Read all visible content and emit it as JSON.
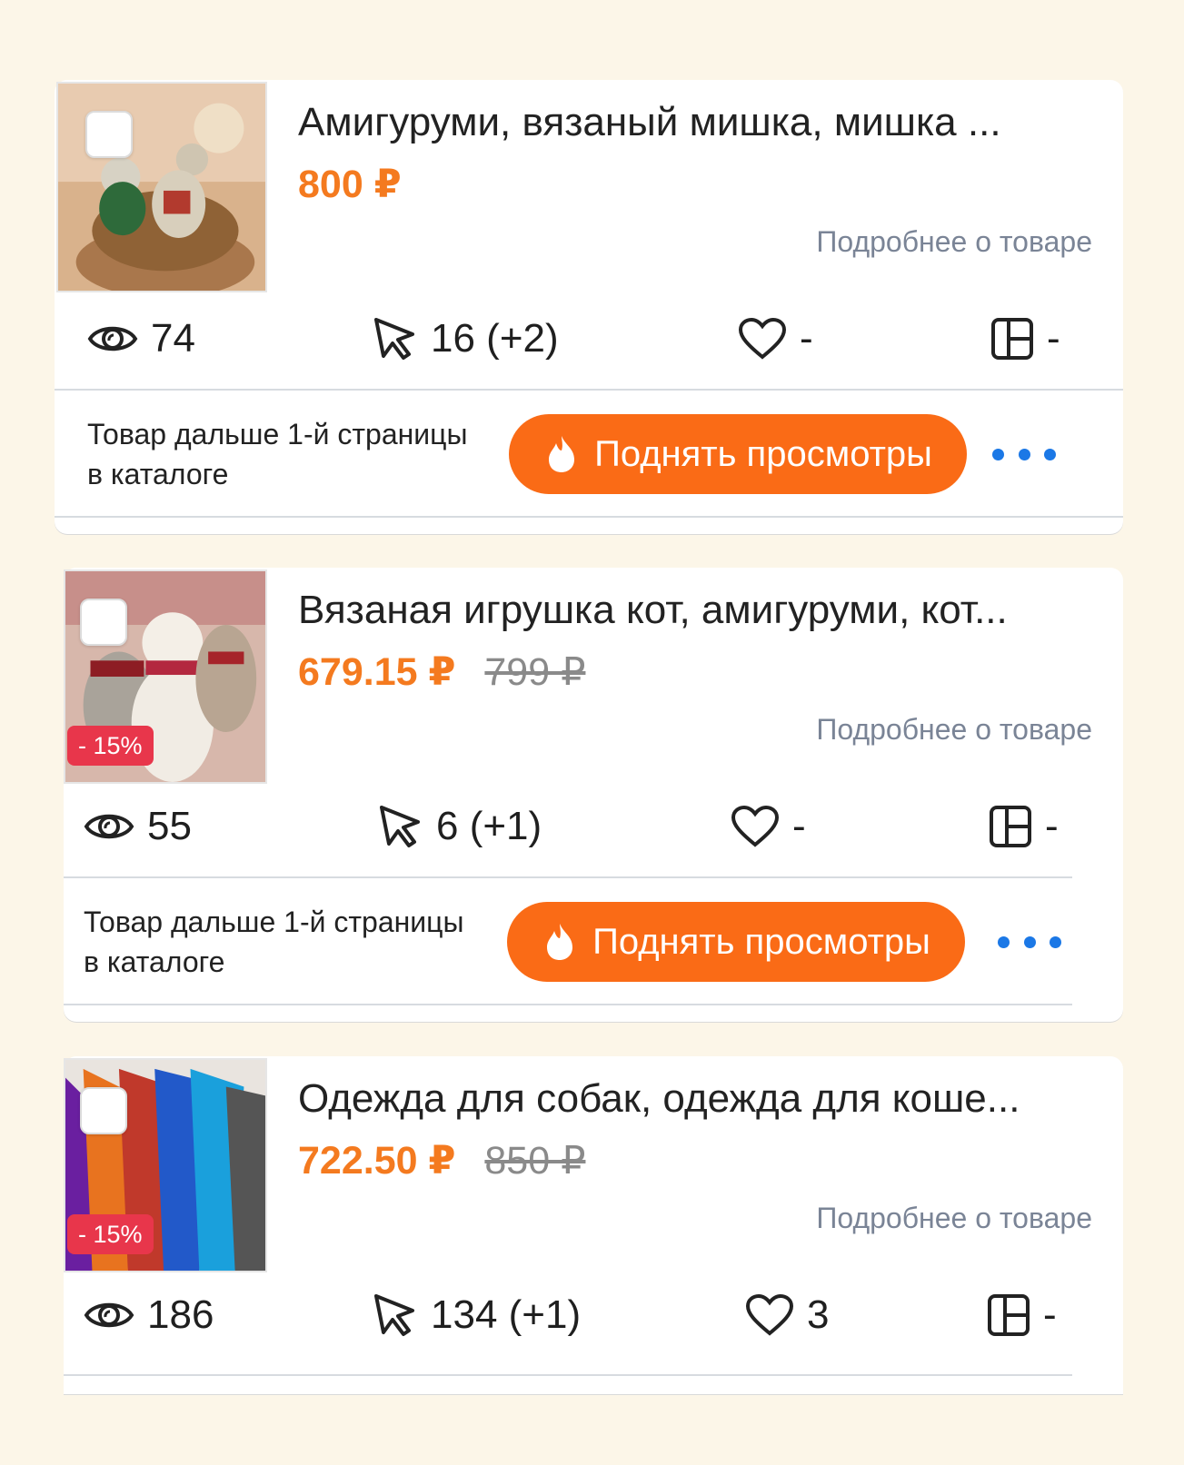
{
  "products": [
    {
      "title": "Амигуруми, вязаный мишка, мишка ...",
      "price": "800 ₽",
      "old_price": "",
      "discount": "",
      "details_link": "Подробнее о товаре",
      "views": "74",
      "clicks": "16 (+2)",
      "favorites": "-",
      "cart": "-",
      "promo_text_line1": "Товар дальше 1-й страницы",
      "promo_text_line2": "в каталоге",
      "boost_button": "Поднять просмотры"
    },
    {
      "title": "Вязаная игрушка кот, амигуруми, кот...",
      "price": "679.15 ₽",
      "old_price": "799 ₽",
      "discount": "- 15%",
      "details_link": "Подробнее о товаре",
      "views": "55",
      "clicks": "6 (+1)",
      "favorites": "-",
      "cart": "-",
      "promo_text_line1": "Товар дальше 1-й страницы",
      "promo_text_line2": "в каталоге",
      "boost_button": "Поднять просмотры"
    },
    {
      "title": "Одежда для собак, одежда для коше...",
      "price": "722.50 ₽",
      "old_price": "850 ₽",
      "discount": "- 15%",
      "details_link": "Подробнее о товаре",
      "views": "186",
      "clicks": "134 (+1)",
      "favorites": "3",
      "cart": "-"
    }
  ],
  "colors": {
    "background": "#fcf6e8",
    "price": "#f47a1f",
    "boost_button": "#fa6b16",
    "discount_badge": "#e8364b",
    "more_dots": "#1b78e6"
  },
  "icons": [
    "eye-icon",
    "cursor-icon",
    "heart-icon",
    "layout-icon",
    "fire-icon",
    "more-icon"
  ]
}
